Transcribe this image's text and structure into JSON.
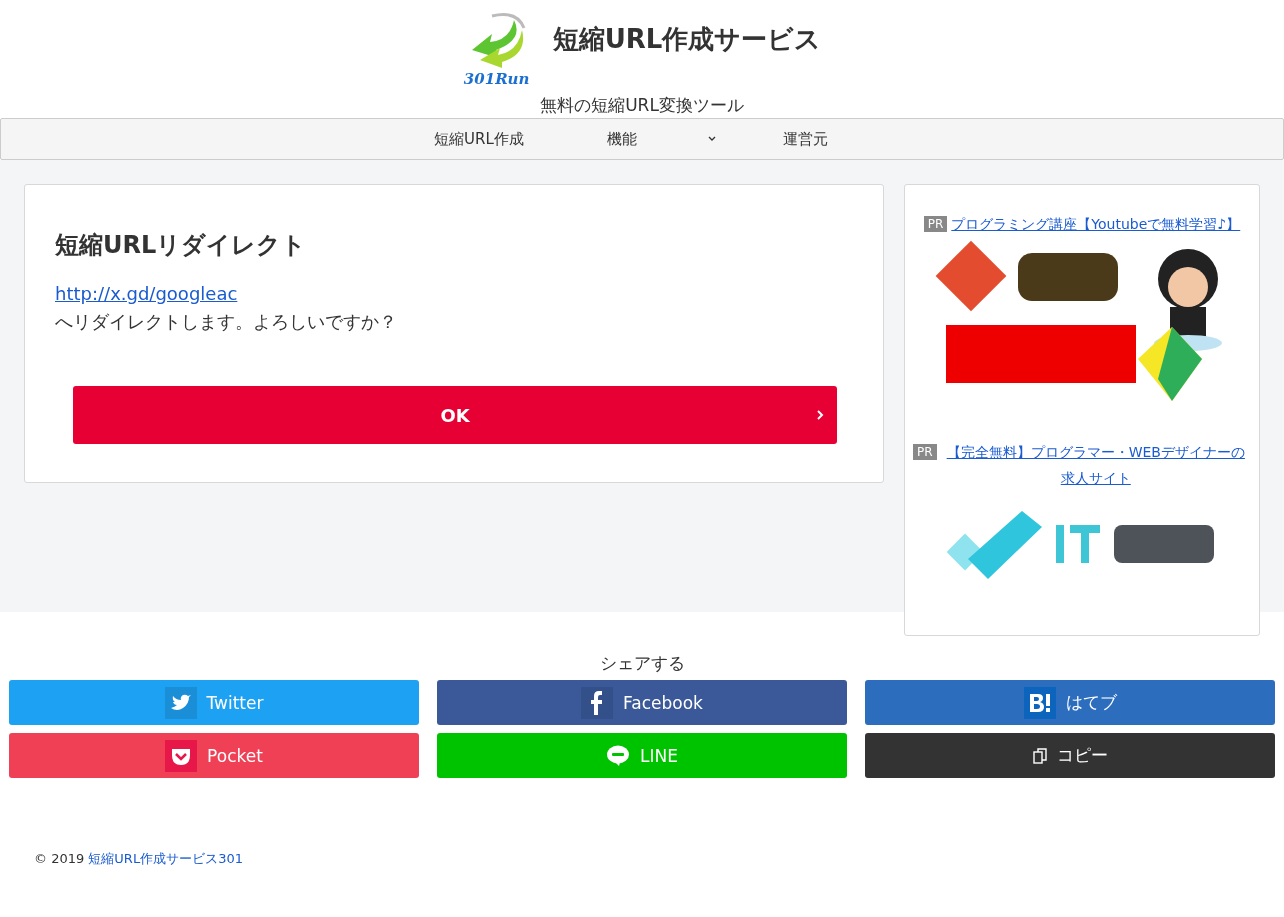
{
  "header": {
    "logo_text": "301Run",
    "title": "短縮URL作成サービス",
    "tagline": "無料の短縮URL変換ツール"
  },
  "nav": [
    {
      "label": "短縮URL作成",
      "has_dropdown": false
    },
    {
      "label": "機能",
      "has_dropdown": true
    },
    {
      "label": "運営元",
      "has_dropdown": false
    }
  ],
  "main": {
    "heading": "短縮URLリダイレクト",
    "link": "http://x.gd/googleac",
    "message": "へリダイレクトします。よろしいですか？",
    "button": "OK"
  },
  "sidebar": {
    "ads": [
      {
        "badge": "PR",
        "link": "プログラミング講座【Youtubeで無料学習♪】"
      },
      {
        "badge": "PR",
        "link": "【完全無料】プログラマー・WEBデザイナーの求人サイト"
      }
    ]
  },
  "share": {
    "heading": "シェアする",
    "buttons": [
      {
        "kind": "twitter",
        "label": "Twitter",
        "color": "#1da1f2"
      },
      {
        "kind": "facebook",
        "label": "Facebook",
        "color": "#3b5998"
      },
      {
        "kind": "hatena",
        "label": "はてブ",
        "color": "#2c6ebd"
      },
      {
        "kind": "pocket",
        "label": "Pocket",
        "color": "#ef4056"
      },
      {
        "kind": "line",
        "label": "LINE",
        "color": "#00c300"
      },
      {
        "kind": "copy",
        "label": "コピー",
        "color": "#333333"
      }
    ]
  },
  "footer": {
    "copyright": "© 2019",
    "link": "短縮URL作成サービス301"
  }
}
